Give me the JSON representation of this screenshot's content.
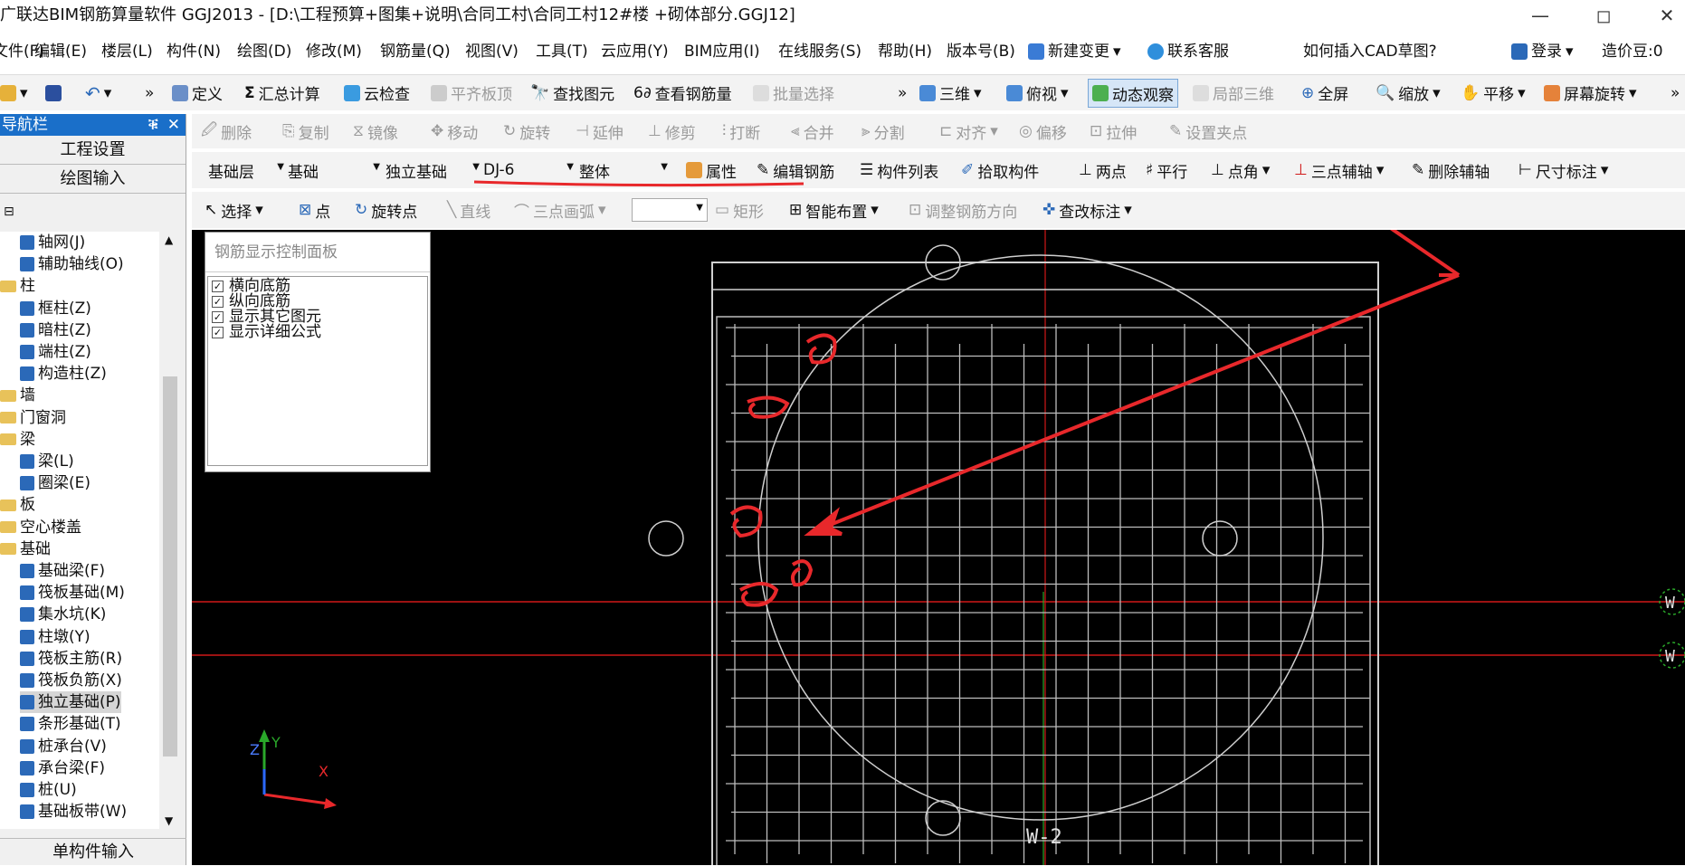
{
  "titlebar": {
    "title": "广联达BIM钢筋算量软件 GGJ2013 - [D:\\工程预算+图集+说明\\合同工村\\合同工村12#楼 +砌体部分.GGJ12]",
    "minimize": "—",
    "maximize": "◻",
    "close": "✕"
  },
  "menubar": {
    "items": [
      "文件(F)",
      "编辑(E)",
      "楼层(L)",
      "构件(N)",
      "绘图(D)",
      "修改(M)",
      "钢筋量(Q)",
      "视图(V)",
      "工具(T)",
      "云应用(Y)",
      "BIM应用(I)",
      "在线服务(S)",
      "帮助(H)",
      "版本号(B)",
      "新建变更",
      "联系客服"
    ],
    "help_link": "如何插入CAD草图?",
    "login": "登录",
    "cost_beans": "造价豆:0"
  },
  "toolbar1": {
    "define": "定义",
    "calc": "汇总计算",
    "cloud_check": "云检查",
    "flat_top": "平齐板顶",
    "find": "查找图元",
    "view_rebar": "查看钢筋量",
    "batch_select": "批量选择",
    "view3d": "三维",
    "top_view": "俯视",
    "dynamic": "动态观察",
    "local3d": "局部三维",
    "fullscreen": "全屏",
    "zoom": "缩放",
    "pan": "平移",
    "rotate": "屏幕旋转"
  },
  "toolbar2": {
    "delete": "删除",
    "copy": "复制",
    "mirror": "镜像",
    "move": "移动",
    "rotate": "旋转",
    "extend": "延伸",
    "trim": "修剪",
    "break": "打断",
    "merge": "合并",
    "split": "分割",
    "align": "对齐",
    "offset": "偏移",
    "stretch": "拉伸",
    "set_point": "设置夹点"
  },
  "toolbar3": {
    "floor": "基础层",
    "category": "基础",
    "type": "独立基础",
    "component": "DJ-6",
    "part": "整体",
    "props": "属性",
    "edit_rebar": "编辑钢筋",
    "comp_list": "构件列表",
    "pick": "拾取构件",
    "two_point": "两点",
    "parallel": "平行",
    "point_angle": "点角",
    "three_point_axis": "三点辅轴",
    "del_axis": "删除辅轴",
    "dim": "尺寸标注"
  },
  "toolbar4": {
    "select": "选择",
    "point": "点",
    "rotate_point": "旋转点",
    "line": "直线",
    "arc": "三点画弧",
    "rect": "矩形",
    "smart": "智能布置",
    "adjust_dir": "调整钢筋方向",
    "edit_mark": "查改标注"
  },
  "nav": {
    "title": "导航栏",
    "pin": "ቑ",
    "close": "✕",
    "project_settings": "工程设置",
    "drawing_input": "绘图输入",
    "single_input": "单构件输入",
    "tree": [
      {
        "label": "轴网(J)",
        "type": "leaf"
      },
      {
        "label": "辅助轴线(O)",
        "type": "leaf"
      },
      {
        "label": "柱",
        "type": "folder"
      },
      {
        "label": "框柱(Z)",
        "type": "leaf"
      },
      {
        "label": "暗柱(Z)",
        "type": "leaf"
      },
      {
        "label": "端柱(Z)",
        "type": "leaf"
      },
      {
        "label": "构造柱(Z)",
        "type": "leaf"
      },
      {
        "label": "墙",
        "type": "folder"
      },
      {
        "label": "门窗洞",
        "type": "folder"
      },
      {
        "label": "梁",
        "type": "folder"
      },
      {
        "label": "梁(L)",
        "type": "leaf"
      },
      {
        "label": "圈梁(E)",
        "type": "leaf"
      },
      {
        "label": "板",
        "type": "folder"
      },
      {
        "label": "空心楼盖",
        "type": "folder"
      },
      {
        "label": "基础",
        "type": "folder"
      },
      {
        "label": "基础梁(F)",
        "type": "leaf"
      },
      {
        "label": "筏板基础(M)",
        "type": "leaf"
      },
      {
        "label": "集水坑(K)",
        "type": "leaf"
      },
      {
        "label": "柱墩(Y)",
        "type": "leaf"
      },
      {
        "label": "筏板主筋(R)",
        "type": "leaf"
      },
      {
        "label": "筏板负筋(X)",
        "type": "leaf"
      },
      {
        "label": "独立基础(P)",
        "type": "leaf",
        "selected": true
      },
      {
        "label": "条形基础(T)",
        "type": "leaf"
      },
      {
        "label": "桩承台(V)",
        "type": "leaf"
      },
      {
        "label": "承台梁(F)",
        "type": "leaf"
      },
      {
        "label": "桩(U)",
        "type": "leaf"
      },
      {
        "label": "基础板带(W)",
        "type": "leaf"
      }
    ]
  },
  "panel": {
    "title": "钢筋显示控制面板",
    "options": [
      {
        "label": "横向底筋",
        "checked": true
      },
      {
        "label": "纵向底筋",
        "checked": true
      },
      {
        "label": "显示其它图元",
        "checked": true
      },
      {
        "label": "显示详细公式",
        "checked": true
      }
    ]
  },
  "canvas": {
    "axis_label": "W-2",
    "axis_right": "W",
    "ucs": {
      "x": "X",
      "y": "Y",
      "z": "Z"
    }
  },
  "colors": {
    "canvas_bg": "#000000",
    "rebar": "#bdbdbd",
    "annotation": "#e8282b",
    "axis_red": "#d01818",
    "nav_header": "#1a6fc9"
  }
}
